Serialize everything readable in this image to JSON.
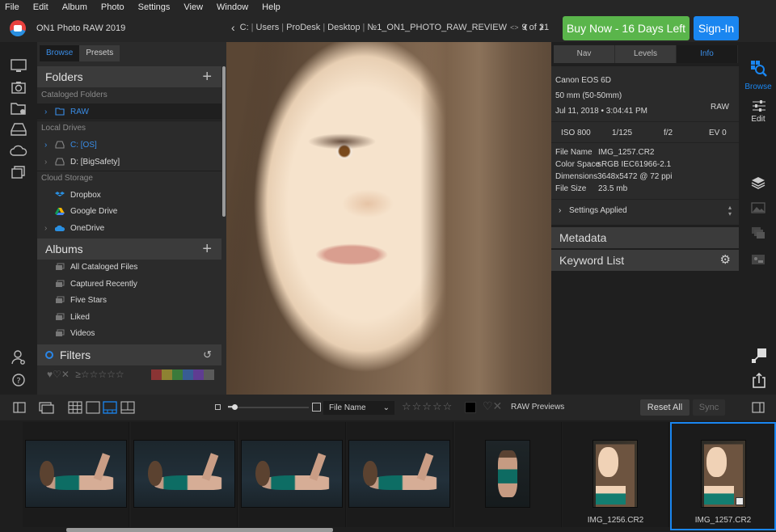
{
  "menu": [
    "File",
    "Edit",
    "Album",
    "Photo",
    "Settings",
    "View",
    "Window",
    "Help"
  ],
  "app": {
    "title": "ON1 Photo RAW 2019",
    "logo_icon": "on1-logo-icon"
  },
  "breadcrumb": {
    "items": [
      "C:",
      "Users",
      "ProDesk",
      "Desktop",
      "№1_ON1_PHOTO_RAW_REVIEW"
    ],
    "position": "9 of 21"
  },
  "header_buttons": {
    "buy": "Buy Now - 16 Days Left",
    "signin": "Sign-In"
  },
  "colors": {
    "accent": "#1a86f0",
    "buy_green": "#5ab54b",
    "link_blue": "#3a8ee8"
  },
  "left_icons": [
    "monitor-icon",
    "camera-icon",
    "folder-heart-icon",
    "drive-icon",
    "cloud-icon",
    "stack-icon",
    "user-settings-icon",
    "help-icon"
  ],
  "left_panel": {
    "tabs": [
      {
        "label": "Browse",
        "active": true
      },
      {
        "label": "Presets",
        "active": false
      }
    ],
    "folders": {
      "title": "Folders",
      "cataloged_label": "Cataloged Folders",
      "cataloged": [
        {
          "label": "RAW",
          "selected": true
        }
      ],
      "local_label": "Local Drives",
      "local": [
        {
          "label": "C: [OS]",
          "active": true
        },
        {
          "label": "D: [BigSafety]",
          "active": false
        }
      ],
      "cloud_label": "Cloud Storage",
      "cloud": [
        {
          "label": "Dropbox"
        },
        {
          "label": "Google Drive"
        },
        {
          "label": "OneDrive"
        }
      ]
    },
    "albums": {
      "title": "Albums",
      "items": [
        "All Cataloged Files",
        "Captured Recently",
        "Five Stars",
        "Liked",
        "Videos"
      ]
    },
    "filters": {
      "title": "Filters",
      "stars_prefix": "≥",
      "color_labels": [
        "#a33a3a",
        "#a79a2b",
        "#3a8a3a",
        "#3a5aa0",
        "#6a3aa0",
        "#6a6a6a"
      ]
    }
  },
  "right_panel": {
    "tabs": [
      {
        "label": "Nav",
        "active": false
      },
      {
        "label": "Levels",
        "active": false
      },
      {
        "label": "Info",
        "active": true
      }
    ],
    "info": {
      "camera": "Canon EOS 6D",
      "lens": "50 mm (50-50mm)",
      "datetime": "Jul 11, 2018 • 3:04:41 PM",
      "format": "RAW",
      "iso": "ISO 800",
      "shutter": "1/125",
      "aperture": "f/2",
      "ev": "EV 0",
      "file_name_label": "File Name",
      "file_name": "IMG_1257.CR2",
      "color_space_label": "Color Space",
      "color_space": "sRGB IEC61966-2.1",
      "dimensions_label": "Dimensions",
      "dimensions": "3648x5472 @ 72 ppi",
      "file_size_label": "File Size",
      "file_size": "23.5 mb",
      "settings_applied": "Settings Applied"
    },
    "metadata": "Metadata",
    "keyword_list": "Keyword List"
  },
  "right_icons": {
    "browse": "Browse",
    "edit": "Edit"
  },
  "toolbar": {
    "sort_by": "File Name",
    "raw_previews": "RAW Previews",
    "reset_all": "Reset All",
    "sync": "Sync",
    "stars": "☆☆☆☆☆"
  },
  "filmstrip": [
    {
      "type": "land",
      "caption": ""
    },
    {
      "type": "land",
      "caption": ""
    },
    {
      "type": "land",
      "caption": ""
    },
    {
      "type": "land",
      "caption": ""
    },
    {
      "type": "port-dark",
      "caption": ""
    },
    {
      "type": "port-light",
      "caption": "IMG_1256.CR2"
    },
    {
      "type": "port-light",
      "caption": "IMG_1257.CR2",
      "selected": true,
      "edited_badge": true
    }
  ]
}
